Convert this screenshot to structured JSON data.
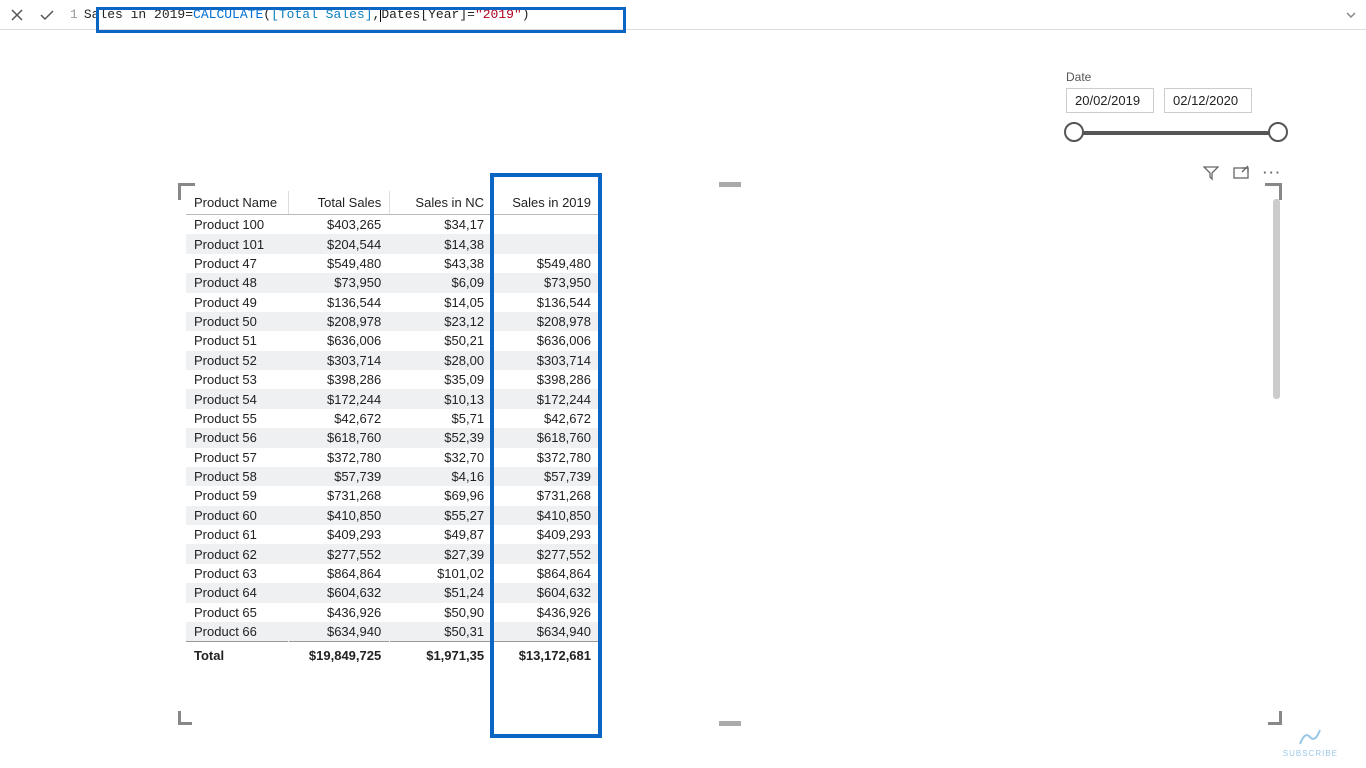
{
  "formula": {
    "line_no": "1",
    "measure_name": "Sales in 2019",
    "eq": " = ",
    "func": "CALCULATE",
    "open_paren": "( ",
    "ref": "[Total Sales]",
    "comma": ", ",
    "col_prefix": "Dates",
    "col_bracket": "[Year]",
    "eq2": " = ",
    "str": "\"2019\"",
    "close_paren": " )"
  },
  "slicer": {
    "label": "Date",
    "start": "20/02/2019",
    "end": "02/12/2020"
  },
  "headers": {
    "c1": "Product Name",
    "c2": "Total Sales",
    "c3": "Sales in NC",
    "c4": "Sales in 2019"
  },
  "rows": [
    {
      "name": "Product 100",
      "total": "$403,265",
      "nc": "$34,17",
      "y2019": ""
    },
    {
      "name": "Product 101",
      "total": "$204,544",
      "nc": "$14,38",
      "y2019": ""
    },
    {
      "name": "Product 47",
      "total": "$549,480",
      "nc": "$43,38",
      "y2019": "$549,480"
    },
    {
      "name": "Product 48",
      "total": "$73,950",
      "nc": "$6,09",
      "y2019": "$73,950"
    },
    {
      "name": "Product 49",
      "total": "$136,544",
      "nc": "$14,05",
      "y2019": "$136,544"
    },
    {
      "name": "Product 50",
      "total": "$208,978",
      "nc": "$23,12",
      "y2019": "$208,978"
    },
    {
      "name": "Product 51",
      "total": "$636,006",
      "nc": "$50,21",
      "y2019": "$636,006"
    },
    {
      "name": "Product 52",
      "total": "$303,714",
      "nc": "$28,00",
      "y2019": "$303,714"
    },
    {
      "name": "Product 53",
      "total": "$398,286",
      "nc": "$35,09",
      "y2019": "$398,286"
    },
    {
      "name": "Product 54",
      "total": "$172,244",
      "nc": "$10,13",
      "y2019": "$172,244"
    },
    {
      "name": "Product 55",
      "total": "$42,672",
      "nc": "$5,71",
      "y2019": "$42,672"
    },
    {
      "name": "Product 56",
      "total": "$618,760",
      "nc": "$52,39",
      "y2019": "$618,760"
    },
    {
      "name": "Product 57",
      "total": "$372,780",
      "nc": "$32,70",
      "y2019": "$372,780"
    },
    {
      "name": "Product 58",
      "total": "$57,739",
      "nc": "$4,16",
      "y2019": "$57,739"
    },
    {
      "name": "Product 59",
      "total": "$731,268",
      "nc": "$69,96",
      "y2019": "$731,268"
    },
    {
      "name": "Product 60",
      "total": "$410,850",
      "nc": "$55,27",
      "y2019": "$410,850"
    },
    {
      "name": "Product 61",
      "total": "$409,293",
      "nc": "$49,87",
      "y2019": "$409,293"
    },
    {
      "name": "Product 62",
      "total": "$277,552",
      "nc": "$27,39",
      "y2019": "$277,552"
    },
    {
      "name": "Product 63",
      "total": "$864,864",
      "nc": "$101,02",
      "y2019": "$864,864"
    },
    {
      "name": "Product 64",
      "total": "$604,632",
      "nc": "$51,24",
      "y2019": "$604,632"
    },
    {
      "name": "Product 65",
      "total": "$436,926",
      "nc": "$50,90",
      "y2019": "$436,926"
    },
    {
      "name": "Product 66",
      "total": "$634,940",
      "nc": "$50,31",
      "y2019": "$634,940"
    }
  ],
  "totals": {
    "label": "Total",
    "total": "$19,849,725",
    "nc": "$1,971,35",
    "y2019": "$13,172,681"
  },
  "watermark": "SUBSCRIBE"
}
